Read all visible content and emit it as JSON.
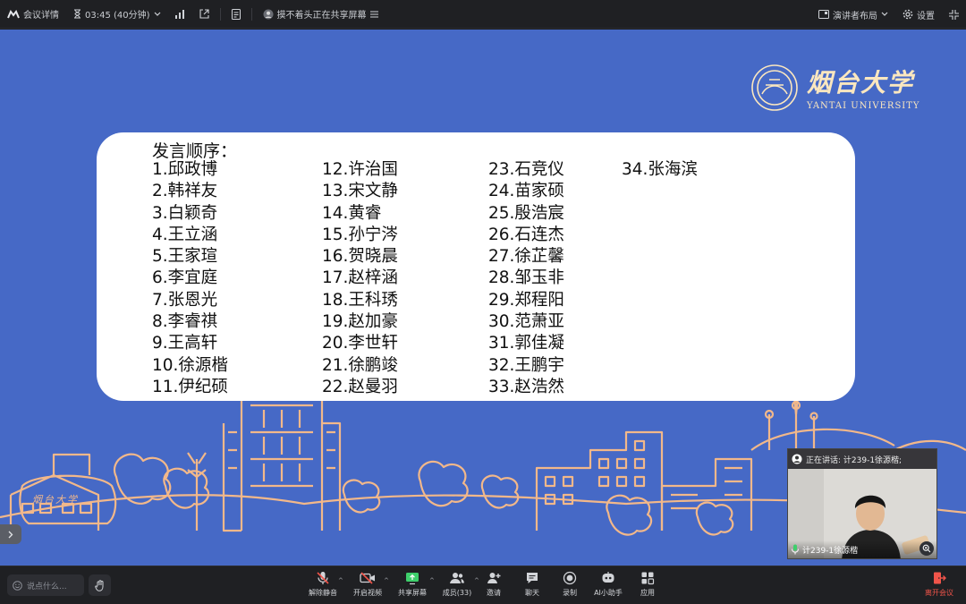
{
  "topbar": {
    "meeting_info": "会议详情",
    "timer": "03:45 (40分钟)",
    "share_status": "摸不着头正在共享屏幕",
    "layout_label": "演讲者布局",
    "settings_label": "设置"
  },
  "slide": {
    "logo": {
      "name_cn": "烟台大学",
      "name_en": "YANTAI UNIVERSITY",
      "stone_text": "烟台大学"
    },
    "title": "发言顺序：",
    "columns": [
      [
        "1.邱政博",
        "2.韩祥友",
        "3.白颖奇",
        "4.王立涵",
        "5.王家瑄",
        "6.李宜庭",
        "7.张恩光",
        "8.李睿祺",
        "9.王高轩",
        "10.徐源楷",
        "11.伊纪硕"
      ],
      [
        "12.许治国",
        "13.宋文静",
        "14.黄睿",
        "15.孙宁涔",
        "16.贺晓晨",
        "17.赵梓涵",
        "18.王科琇",
        "19.赵加豪",
        "20.李世轩",
        "21.徐鹏竣",
        "22.赵曼羽"
      ],
      [
        "23.石竞仪",
        "24.苗家硕",
        "25.殷浩宸",
        "26.石连杰",
        "27.徐芷馨",
        "28.邹玉非",
        "29.郑程阳",
        "30.范萧亚",
        "31.郭佳凝",
        "32.王鹏宇",
        "33.赵浩然"
      ],
      [
        "34.张海滨"
      ]
    ]
  },
  "speaker": {
    "speaking_label": "正在讲话: 计239-1徐源楷;",
    "name": "计239-1徐源楷"
  },
  "bottombar": {
    "chat_placeholder": "说点什么...",
    "tools": [
      "解除静音",
      "开启视频",
      "共享屏幕",
      "成员(33)",
      "邀请",
      "聊天",
      "录制",
      "AI小助手",
      "应用"
    ],
    "leave_label": "离开会议"
  },
  "colors": {
    "stage_bg": "#4669c6",
    "illustration": "#f2b88a",
    "logo": "#fbe7bf",
    "leave": "#f0544a"
  }
}
